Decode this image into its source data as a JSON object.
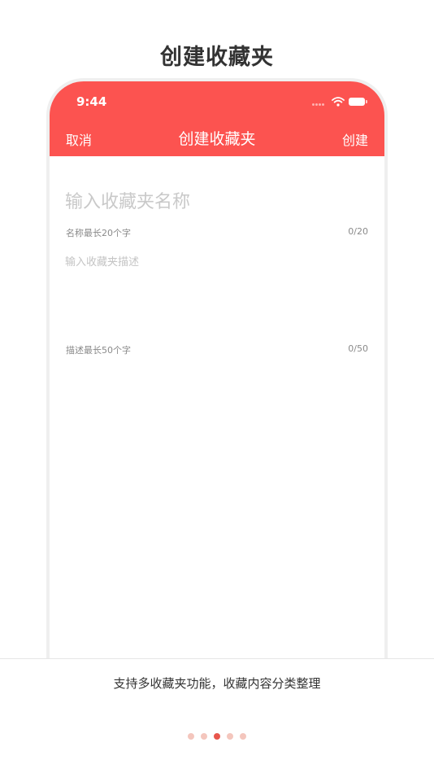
{
  "page": {
    "title": "创建收藏夹",
    "caption": "支持多收藏夹功能，收藏内容分类整理"
  },
  "status_bar": {
    "time": "9:44",
    "icons": [
      "signal-dots-icon",
      "wifi-icon",
      "battery-icon"
    ]
  },
  "nav": {
    "cancel_label": "取消",
    "title": "创建收藏夹",
    "create_label": "创建"
  },
  "form": {
    "name_placeholder": "输入收藏夹名称",
    "name_value": "",
    "name_hint": "名称最长20个字",
    "name_count": "0/20",
    "desc_placeholder": "输入收藏夹描述",
    "desc_value": "",
    "desc_hint": "描述最长50个字",
    "desc_count": "0/50"
  },
  "pager": {
    "pages": [
      1,
      2,
      3,
      4,
      5
    ],
    "active_index": 2
  },
  "colors": {
    "accent": "#fc5350",
    "dot_active": "#e8564c",
    "dot_inactive": "#f4c6bd",
    "title_text": "#333333",
    "placeholder": "#c9c9c9"
  }
}
